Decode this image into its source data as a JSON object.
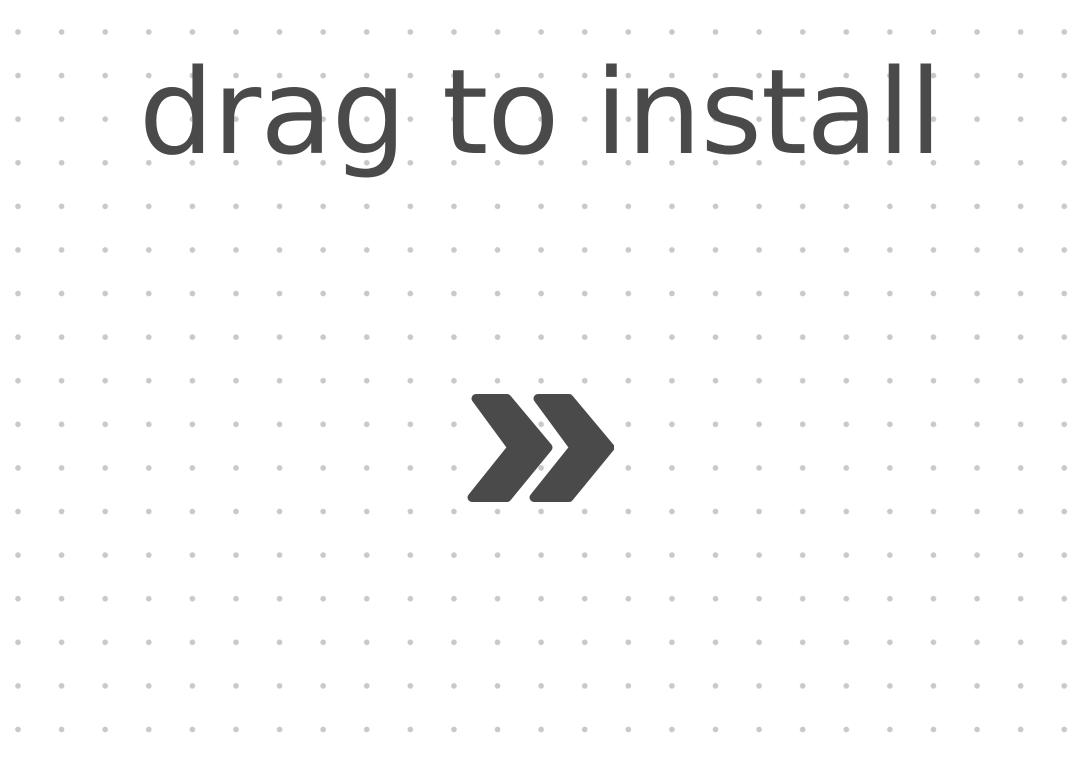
{
  "install_prompt": {
    "title": "drag to install",
    "arrow_icon": "double-chevron-right-icon"
  },
  "colors": {
    "text": "#4a4a4a",
    "dots": "#c9c9c9",
    "background": "#ffffff"
  }
}
